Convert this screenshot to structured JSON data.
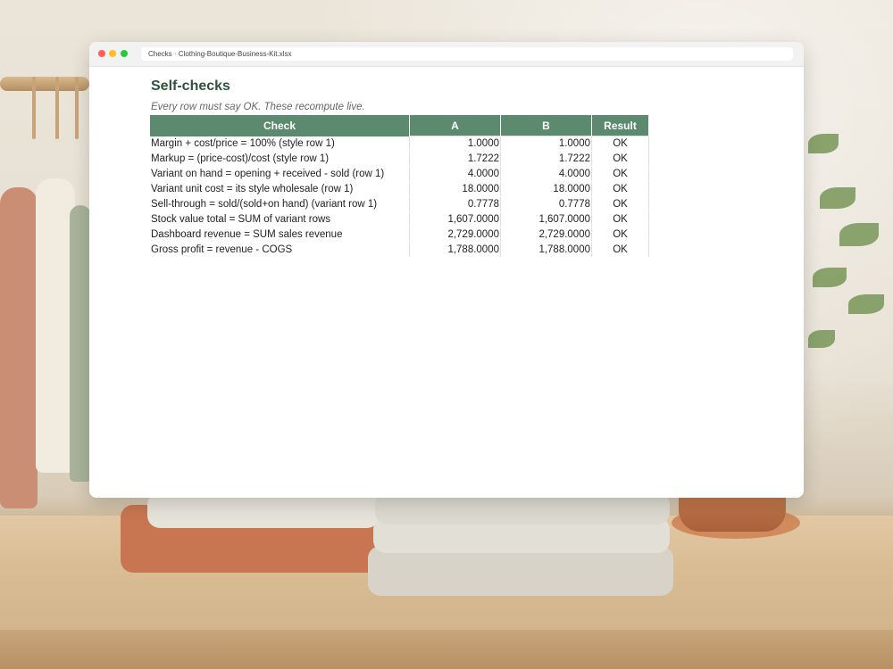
{
  "window": {
    "address": "Checks · Clothing-Boutique-Business-Kit.xlsx"
  },
  "sheet": {
    "title": "Self-checks",
    "subtitle": "Every row must say OK. These recompute live.",
    "columns": [
      "Check",
      "A",
      "B",
      "Result"
    ],
    "rows": [
      {
        "check": "Margin + cost/price = 100% (style row 1)",
        "a": "1.0000",
        "b": "1.0000",
        "result": "OK"
      },
      {
        "check": "Markup = (price-cost)/cost (style row 1)",
        "a": "1.7222",
        "b": "1.7222",
        "result": "OK"
      },
      {
        "check": "Variant on hand = opening + received - sold (row 1)",
        "a": "4.0000",
        "b": "4.0000",
        "result": "OK"
      },
      {
        "check": "Variant unit cost = its style wholesale (row 1)",
        "a": "18.0000",
        "b": "18.0000",
        "result": "OK"
      },
      {
        "check": "Sell-through = sold/(sold+on hand) (variant row 1)",
        "a": "0.7778",
        "b": "0.7778",
        "result": "OK"
      },
      {
        "check": "Stock value total = SUM of variant rows",
        "a": "1,607.0000",
        "b": "1,607.0000",
        "result": "OK"
      },
      {
        "check": "Dashboard revenue = SUM sales revenue",
        "a": "2,729.0000",
        "b": "2,729.0000",
        "result": "OK"
      },
      {
        "check": "Gross profit = revenue - COGS",
        "a": "1,788.0000",
        "b": "1,788.0000",
        "result": "OK"
      }
    ]
  },
  "colors": {
    "header_bg": "#5b8a6e",
    "title": "#2f5240"
  }
}
